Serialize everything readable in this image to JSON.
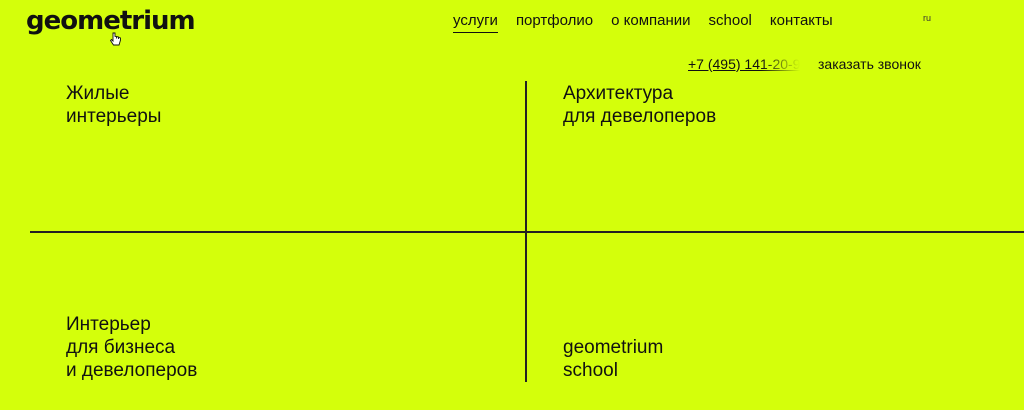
{
  "header": {
    "logo": "geometrium",
    "nav": [
      {
        "label": "услуги",
        "active": true
      },
      {
        "label": "портфолио",
        "active": false
      },
      {
        "label": "о компании",
        "active": false
      },
      {
        "label": "school",
        "active": false
      },
      {
        "label": "контакты",
        "active": false
      }
    ],
    "lang": "ru",
    "phone": "+7 (495) 141-20-9",
    "callback": "заказать звонок"
  },
  "tiles": [
    {
      "lines": [
        "Жилые",
        "интерьеры"
      ]
    },
    {
      "lines": [
        "Архитектура",
        "для девелоперов"
      ]
    },
    {
      "lines": [
        "Интерьер",
        "для бизнеса",
        "и девелоперов"
      ]
    },
    {
      "lines": [
        "geometrium",
        "school"
      ]
    }
  ],
  "colors": {
    "background": "#d4ff0b",
    "text": "#111111"
  },
  "icons": {
    "cursor": "hand-pointer-icon"
  }
}
